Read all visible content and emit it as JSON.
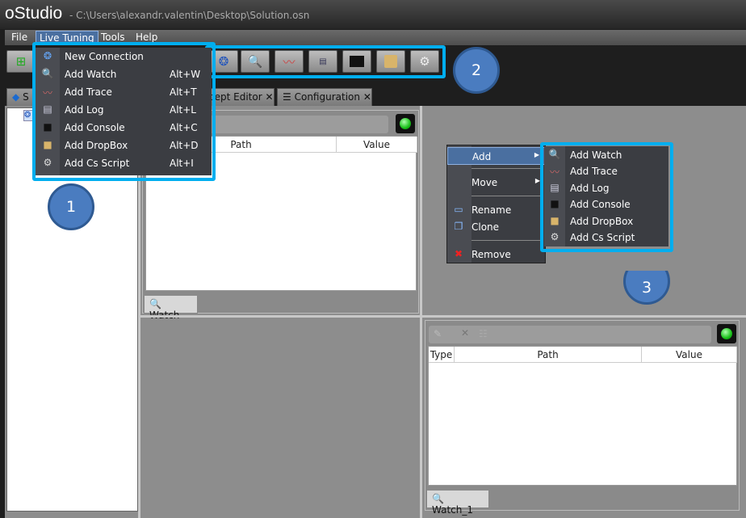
{
  "window": {
    "title": "oStudio",
    "path": "- C:\\Users\\alexandr.valentin\\Desktop\\Solution.osn"
  },
  "menubar": [
    "File",
    "Live Tuning",
    "Tools",
    "Help"
  ],
  "toolbar": {
    "icons": [
      "new-window-icon",
      "connection-icon",
      "watch-icon",
      "trace-icon",
      "log-icon",
      "console-icon",
      "dropbox-icon",
      "cs-script-icon"
    ]
  },
  "tabs": [
    {
      "label": "S"
    },
    {
      "label": "cept Editor"
    },
    {
      "label": "Configuration"
    }
  ],
  "live_tuning_menu": [
    {
      "label": "New Connection",
      "shortcut": "",
      "icon": "connection-icon"
    },
    {
      "label": "Add Watch",
      "shortcut": "Alt+W",
      "icon": "watch-icon"
    },
    {
      "label": "Add Trace",
      "shortcut": "Alt+T",
      "icon": "trace-icon"
    },
    {
      "label": "Add Log",
      "shortcut": "Alt+L",
      "icon": "log-icon"
    },
    {
      "label": "Add Console",
      "shortcut": "Alt+C",
      "icon": "console-icon"
    },
    {
      "label": "Add DropBox",
      "shortcut": "Alt+D",
      "icon": "dropbox-icon"
    },
    {
      "label": "Add Cs Script",
      "shortcut": "Alt+I",
      "icon": "cs-script-icon"
    }
  ],
  "watch_pane": {
    "columns": [
      "Path",
      "Value"
    ],
    "tab": "Watch"
  },
  "watch1_pane": {
    "columns": [
      "Type",
      "Path",
      "Value"
    ],
    "tab": "Watch_1"
  },
  "context_menu": [
    "Add",
    "Move",
    "Rename",
    "Clone",
    "Remove"
  ],
  "add_submenu": [
    "Add Watch",
    "Add Trace",
    "Add Log",
    "Add Console",
    "Add DropBox",
    "Add Cs Script"
  ],
  "callouts": [
    "1",
    "2",
    "3"
  ],
  "colors": {
    "highlight": "#00aeef",
    "callout": "#4a7cc0",
    "led": "#18c018"
  }
}
